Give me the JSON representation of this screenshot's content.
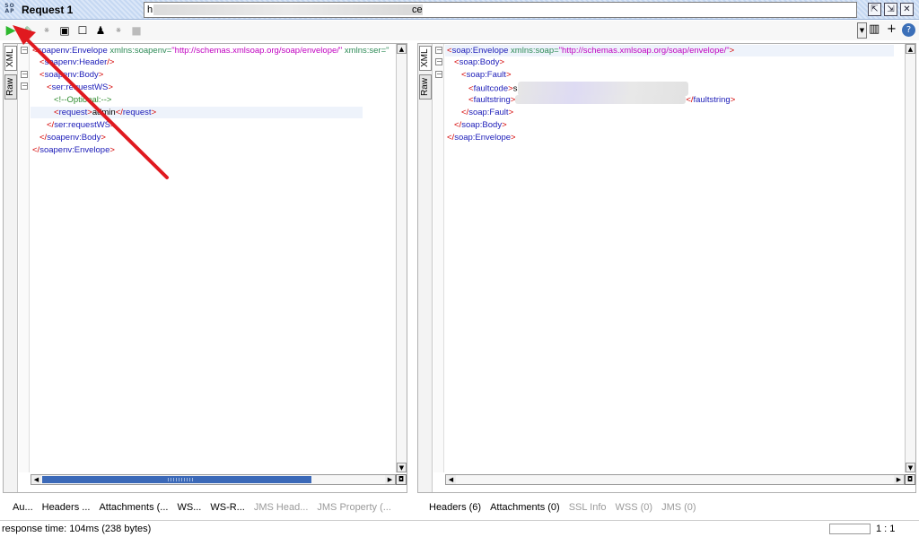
{
  "window": {
    "title": "Request 1",
    "logo_text": "SO AP"
  },
  "toolbar": {
    "url_value": "h",
    "url_suffix": "ce",
    "icons": [
      "play-icon",
      "stop-icon",
      "add-icon",
      "clone-icon",
      "blank-icon",
      "user-icon",
      "disabled-icon"
    ]
  },
  "left_panel": {
    "tab_xml": "XML",
    "tab_raw": "Raw",
    "lines": [
      {
        "open": "<",
        "tag": "soapenv:Envelope",
        "attr": " xmlns:soapenv=",
        "val": "\"http://schemas.xmlsoap.org/soap/envelope/\"",
        "attr2": " xmlns:ser=\""
      },
      {
        "open": "<",
        "tag": "soapenv:Header",
        "close": "/>"
      },
      {
        "open": "<",
        "tag": "soapenv:Body",
        "close": ">"
      },
      {
        "open": "<",
        "tag": "ser:requestWS",
        "close": ">"
      },
      {
        "comment": "<!--Optional:-->"
      },
      {
        "open": "<",
        "tag": "request",
        "close": ">",
        "text": "admin",
        "endopen": "</",
        "endtag": "request",
        "endclose": ">"
      },
      {
        "open": "</",
        "tag": "ser:requestWS",
        "close": ">"
      },
      {
        "open": "</",
        "tag": "soapenv:Body",
        "close": ">"
      },
      {
        "open": "</",
        "tag": "soapenv:Envelope",
        "close": ">"
      }
    ]
  },
  "right_panel": {
    "tab_xml": "XML",
    "tab_raw": "Raw",
    "lines": [
      {
        "open": "<",
        "tag": "soap:Envelope",
        "attr": " xmlns:soap=",
        "val": "\"http://schemas.xmlsoap.org/soap/envelope/\"",
        "close": ">"
      },
      {
        "open": "<",
        "tag": "soap:Body",
        "close": ">"
      },
      {
        "open": "<",
        "tag": "soap:Fault",
        "close": ">"
      },
      {
        "open": "<",
        "tag": "faultcode",
        "close": ">",
        "text": "s"
      },
      {
        "open": "<",
        "tag": "faultstring",
        "close": ">",
        "endopen": "</",
        "endtag": "faultstring",
        "endclose": ">"
      },
      {
        "open": "</",
        "tag": "soap:Fault",
        "close": ">"
      },
      {
        "open": "</",
        "tag": "soap:Body",
        "close": ">"
      },
      {
        "open": "</",
        "tag": "soap:Envelope",
        "close": ">"
      }
    ]
  },
  "left_tabs": [
    "Au...",
    "Headers ...",
    "Attachments (...",
    "WS...",
    "WS-R...",
    "JMS Head...",
    "JMS Property (..."
  ],
  "right_tabs": [
    "Headers (6)",
    "Attachments (0)",
    "SSL Info",
    "WSS (0)",
    "JMS (0)"
  ],
  "status": {
    "response_time": "response time: 104ms (238 bytes)",
    "cursor_position": "1 : 1"
  },
  "colors": {
    "annotation_arrow": "#e0191f",
    "play_green": "#2eb82e"
  }
}
